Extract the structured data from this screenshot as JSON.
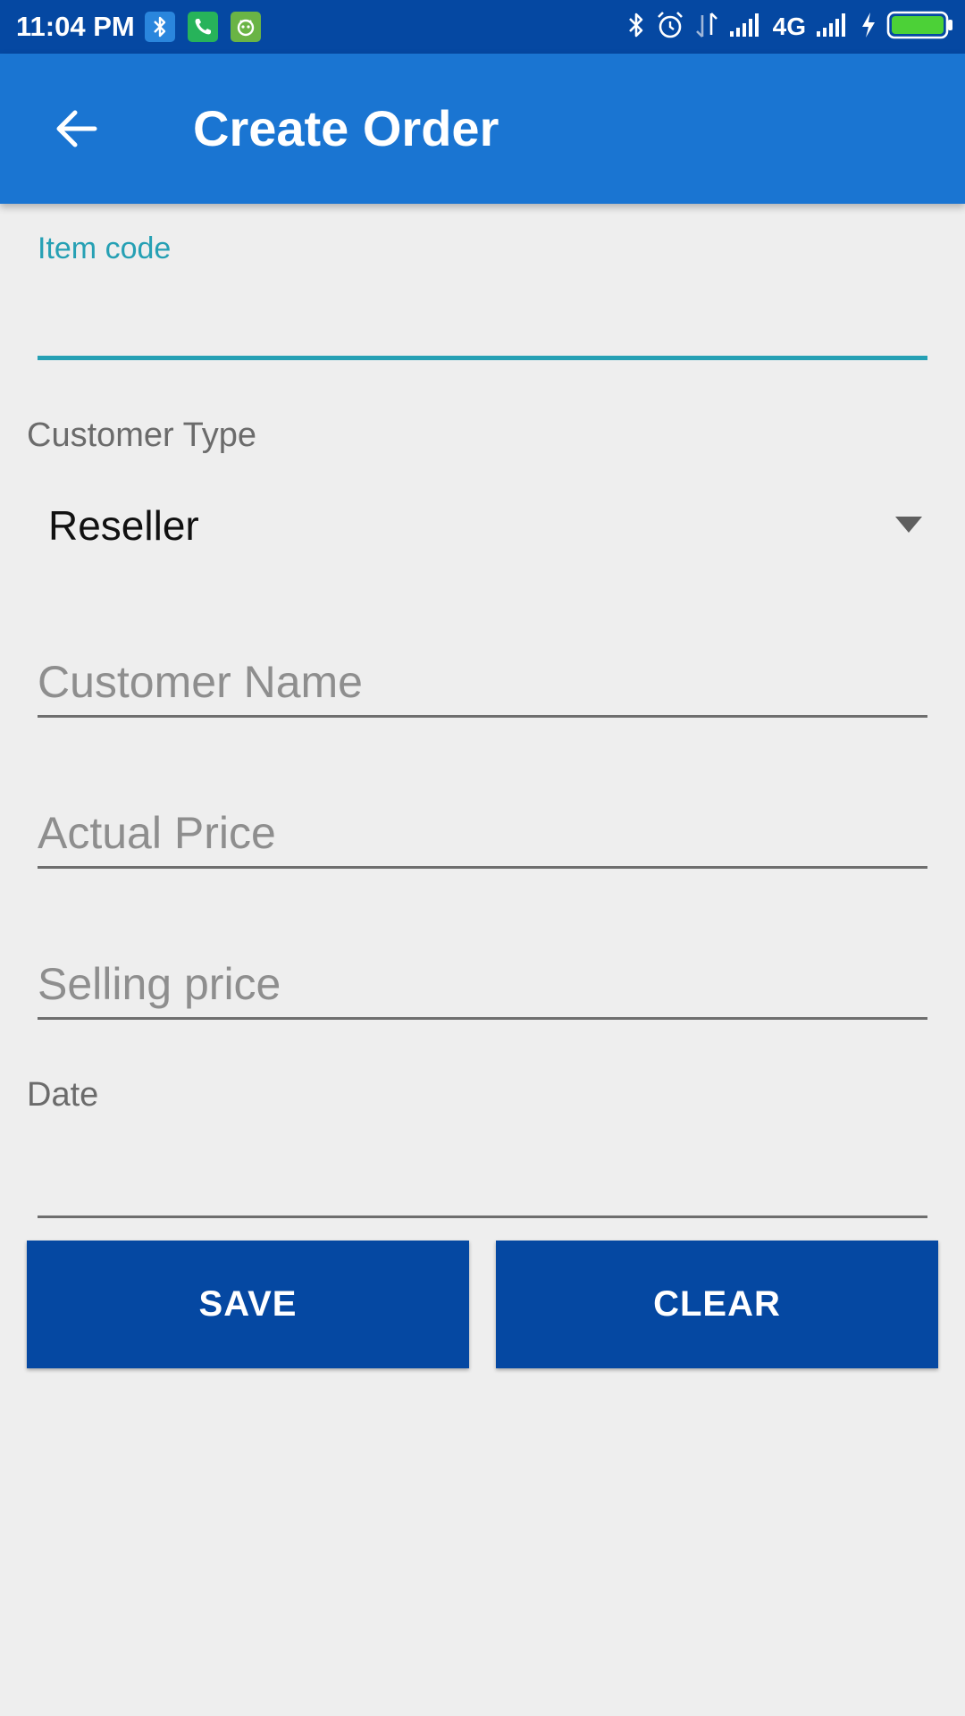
{
  "status_bar": {
    "time": "11:04 PM",
    "network": "4G",
    "icons": [
      "bluetooth-app-icon",
      "phone-app-icon",
      "android-app-icon",
      "bluetooth-icon",
      "alarm-icon",
      "data-transfer-icon",
      "signal-icon",
      "signal-2-icon",
      "charging-icon",
      "battery-icon"
    ],
    "battery_fill_fraction": 1.0,
    "colors": {
      "bar": "#0548a2",
      "battery": "#4cd137"
    }
  },
  "app_bar": {
    "title": "Create Order",
    "back_icon": "arrow-back-icon",
    "color": "#1a75d2"
  },
  "form": {
    "item_code": {
      "label": "Item code",
      "value": ""
    },
    "customer_type": {
      "label": "Customer Type",
      "selected": "Reseller",
      "icon": "dropdown-arrow-icon"
    },
    "customer_name": {
      "placeholder": "Customer Name",
      "value": ""
    },
    "actual_price": {
      "placeholder": "Actual Price",
      "value": ""
    },
    "selling_price": {
      "placeholder": "Selling price",
      "value": ""
    },
    "date": {
      "label": "Date",
      "value": ""
    },
    "accent_color": "#26a0b4"
  },
  "actions": {
    "save_label": "SAVE",
    "clear_label": "CLEAR",
    "button_color": "#0548a2"
  }
}
